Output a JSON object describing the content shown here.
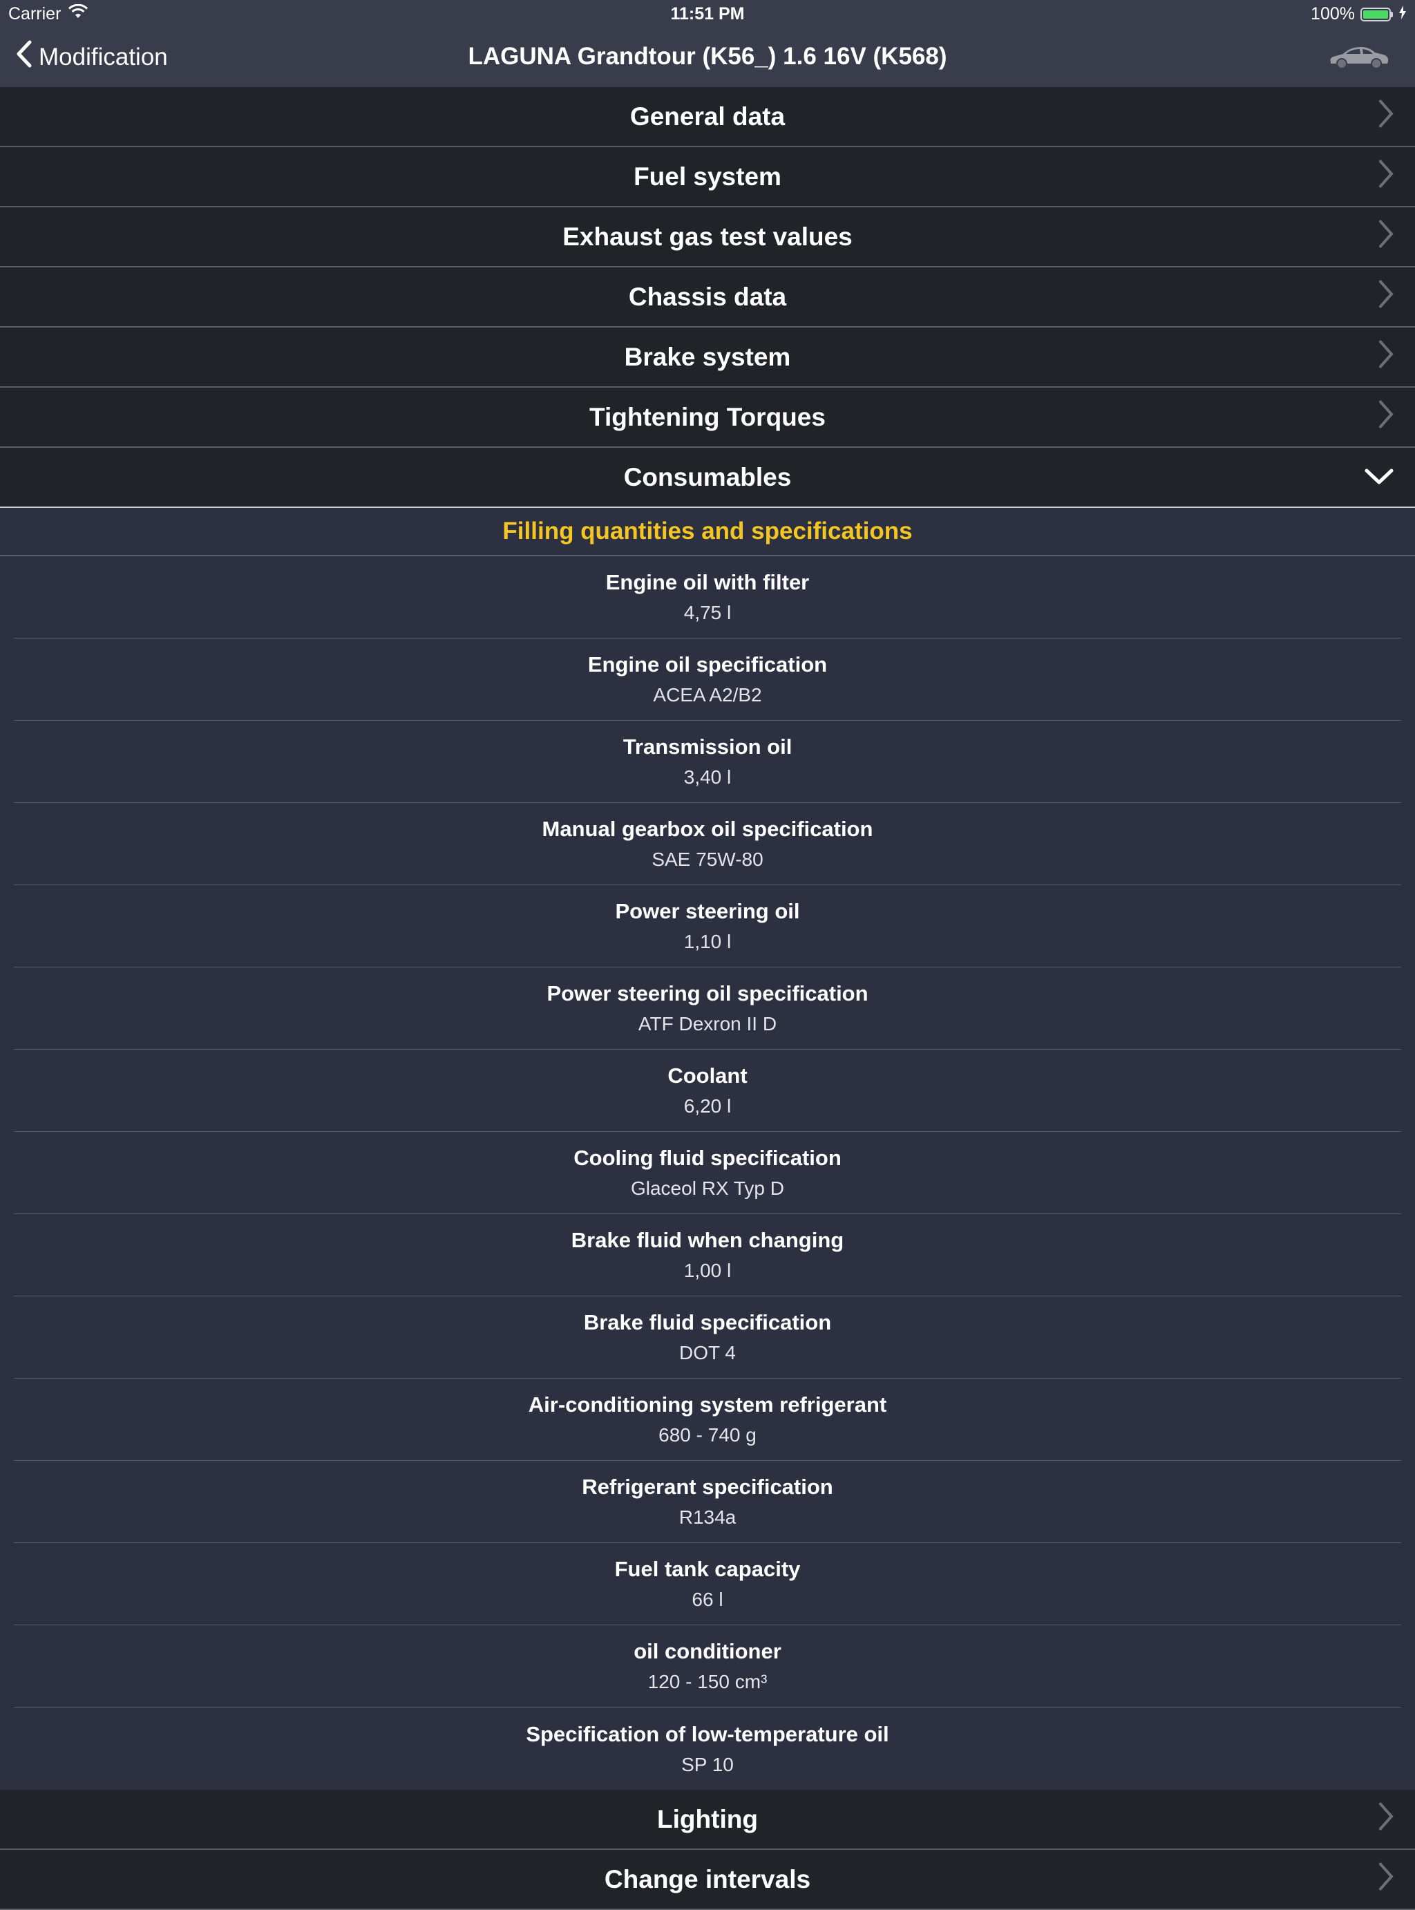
{
  "status_bar": {
    "carrier": "Carrier",
    "time": "11:51 PM",
    "battery_text": "100%",
    "battery_level": 1.0,
    "battery_color": "#4cd964"
  },
  "nav": {
    "back_label": "Modification",
    "title": "LAGUNA Grandtour (K56_) 1.6 16V (K568)",
    "car_icon": "car-icon"
  },
  "categories_top": [
    {
      "label": "General data"
    },
    {
      "label": "Fuel system"
    },
    {
      "label": "Exhaust gas test values"
    },
    {
      "label": "Chassis data"
    },
    {
      "label": "Brake system"
    },
    {
      "label": "Tightening Torques"
    },
    {
      "label": "Consumables"
    }
  ],
  "section": {
    "title": "Filling quantities and specifications",
    "title_color": "#f3c623"
  },
  "items": [
    {
      "label": "Engine oil with filter",
      "value": "4,75 l"
    },
    {
      "label": "Engine oil specification",
      "value": "ACEA A2/B2"
    },
    {
      "label": "Transmission oil",
      "value": "3,40 l"
    },
    {
      "label": "Manual gearbox oil specification",
      "value": "SAE 75W-80"
    },
    {
      "label": "Power steering oil",
      "value": "1,10 l"
    },
    {
      "label": "Power steering oil specification",
      "value": "ATF Dexron II D"
    },
    {
      "label": "Coolant",
      "value": "6,20 l"
    },
    {
      "label": "Cooling fluid specification",
      "value": "Glaceol RX Typ D"
    },
    {
      "label": "Brake fluid when changing",
      "value": "1,00 l"
    },
    {
      "label": "Brake fluid specification",
      "value": "DOT 4"
    },
    {
      "label": "Air-conditioning system refrigerant",
      "value": "680 - 740 g"
    },
    {
      "label": "Refrigerant specification",
      "value": "R134a"
    },
    {
      "label": "Fuel tank capacity",
      "value": "66 l"
    },
    {
      "label": "oil conditioner",
      "value": "120 - 150 cm³"
    },
    {
      "label": "Specification of low-temperature oil",
      "value": "SP 10"
    }
  ],
  "categories_bottom": [
    {
      "label": "Lighting"
    },
    {
      "label": "Change intervals"
    }
  ]
}
